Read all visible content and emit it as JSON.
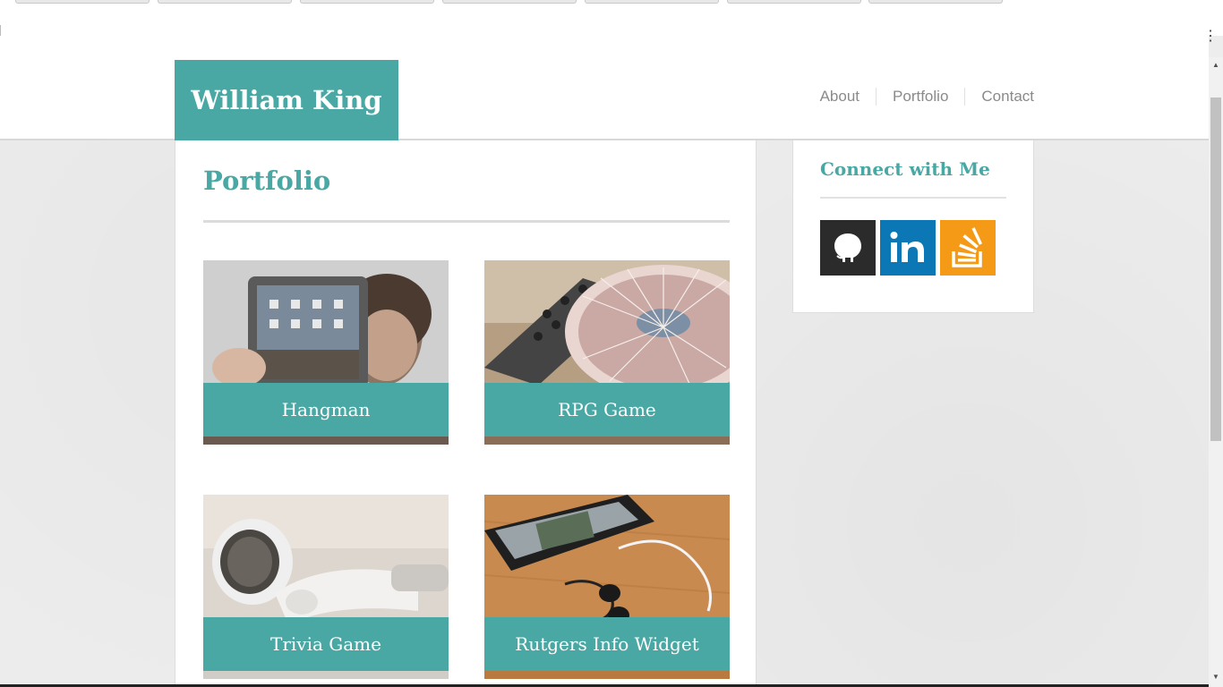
{
  "brand": {
    "name": "William King"
  },
  "nav": {
    "items": [
      "About",
      "Portfolio",
      "Contact"
    ]
  },
  "main": {
    "title": "Portfolio",
    "projects": [
      {
        "label": "Hangman"
      },
      {
        "label": "RPG Game"
      },
      {
        "label": "Trivia Game"
      },
      {
        "label": "Rutgers Info Widget"
      }
    ]
  },
  "sidebar": {
    "title": "Connect with Me",
    "social": [
      {
        "icon": "github-icon",
        "color": "#2b2b2b"
      },
      {
        "icon": "linkedin-icon",
        "color": "#0b77b5"
      },
      {
        "icon": "stackoverflow-icon",
        "color": "#f59a16"
      }
    ]
  },
  "colors": {
    "accent": "#4aa8a4",
    "nav_text": "#8a8a8a"
  }
}
